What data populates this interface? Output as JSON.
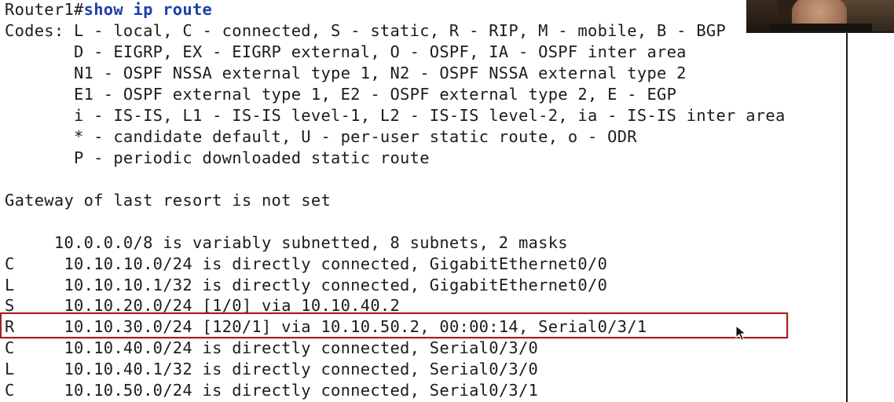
{
  "terminal": {
    "prompt": "Router1#",
    "command": "show ip route",
    "codes_lines": [
      "Codes: L - local, C - connected, S - static, R - RIP, M - mobile, B - BGP",
      "       D - EIGRP, EX - EIGRP external, O - OSPF, IA - OSPF inter area",
      "       N1 - OSPF NSSA external type 1, N2 - OSPF NSSA external type 2",
      "       E1 - OSPF external type 1, E2 - OSPF external type 2, E - EGP",
      "       i - IS-IS, L1 - IS-IS level-1, L2 - IS-IS level-2, ia - IS-IS inter area",
      "       * - candidate default, U - per-user static route, o - ODR",
      "       P - periodic downloaded static route"
    ],
    "gateway_line": "Gateway of last resort is not set",
    "summary_line": "     10.0.0.0/8 is variably subnetted, 8 subnets, 2 masks",
    "routes": [
      {
        "code": "C",
        "text": "10.10.10.0/24 is directly connected, GigabitEthernet0/0"
      },
      {
        "code": "L",
        "text": "10.10.10.1/32 is directly connected, GigabitEthernet0/0"
      },
      {
        "code": "S",
        "text": "10.10.20.0/24 [1/0] via 10.10.40.2"
      },
      {
        "code": "R",
        "text": "10.10.30.0/24 [120/1] via 10.10.50.2, 00:00:14, Serial0/3/1"
      },
      {
        "code": "C",
        "text": "10.10.40.0/24 is directly connected, Serial0/3/0"
      },
      {
        "code": "L",
        "text": "10.10.40.1/32 is directly connected, Serial0/3/0"
      },
      {
        "code": "C",
        "text": "10.10.50.0/24 is directly connected, Serial0/3/1"
      }
    ]
  },
  "highlight": {
    "row": "R",
    "color": "#a3201a"
  },
  "colors": {
    "command": "#1f3fa8",
    "text": "#1c1c1c",
    "background": "#ffffff"
  },
  "icons": {
    "cursor": "mouse-pointer-icon"
  }
}
